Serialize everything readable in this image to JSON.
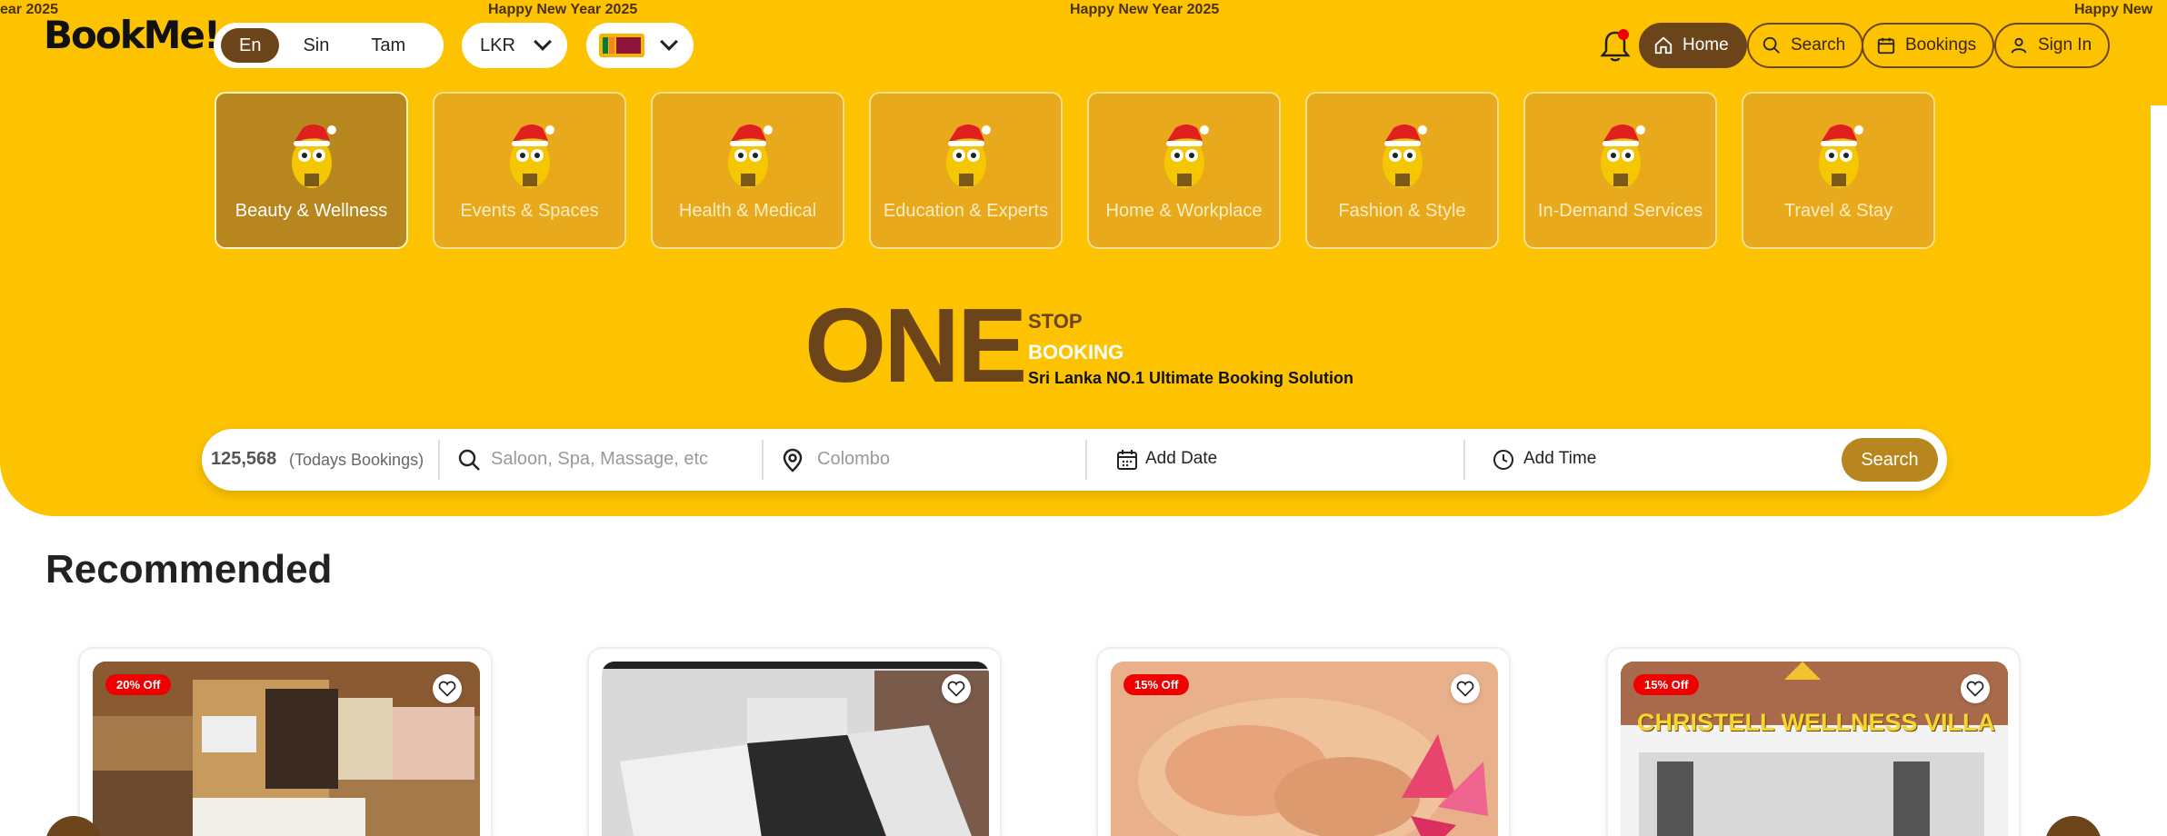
{
  "marquee": [
    "ear 2025",
    "Happy New Year 2025",
    "Happy New Year 2025",
    "Happy New"
  ],
  "logo": "BookMe!",
  "languages": [
    {
      "label": "En",
      "active": true
    },
    {
      "label": "Sin",
      "active": false
    },
    {
      "label": "Tam",
      "active": false
    }
  ],
  "currency": "LKR",
  "country_icon": "sri-lanka-flag",
  "nav": {
    "home": "Home",
    "search": "Search",
    "bookings": "Bookings",
    "signin": "Sign In"
  },
  "categories": [
    {
      "label": "Beauty & Wellness",
      "active": true
    },
    {
      "label": "Events & Spaces",
      "active": false
    },
    {
      "label": "Health & Medical",
      "active": false
    },
    {
      "label": "Education & Experts",
      "active": false
    },
    {
      "label": "Home & Workplace",
      "active": false
    },
    {
      "label": "Fashion & Style",
      "active": false
    },
    {
      "label": "In-Demand Services",
      "active": false
    },
    {
      "label": "Travel & Stay",
      "active": false
    }
  ],
  "headline": {
    "big": "ONE",
    "stop": "STOP",
    "booking": "BOOKING",
    "tagline": "Sri Lanka NO.1 Ultimate Booking Solution"
  },
  "searchbar": {
    "count": "125,568",
    "count_label": "(Todays Bookings)",
    "service_placeholder": "Saloon, Spa, Massage, etc",
    "location_placeholder": "Colombo",
    "date_label": "Add Date",
    "time_label": "Add Time",
    "button": "Search"
  },
  "recommended": {
    "title": "Recommended",
    "cards": [
      {
        "badge": "20% Off"
      },
      {
        "badge": ""
      },
      {
        "badge": "15% Off"
      },
      {
        "badge": "15% Off",
        "sign": "CHRISTELL WELLNESS VILLA"
      }
    ]
  },
  "colors": {
    "brand_yellow": "#FEC300",
    "brand_brown": "#6b4419",
    "accent_gold": "#b8861e",
    "badge_red": "#e00000"
  }
}
